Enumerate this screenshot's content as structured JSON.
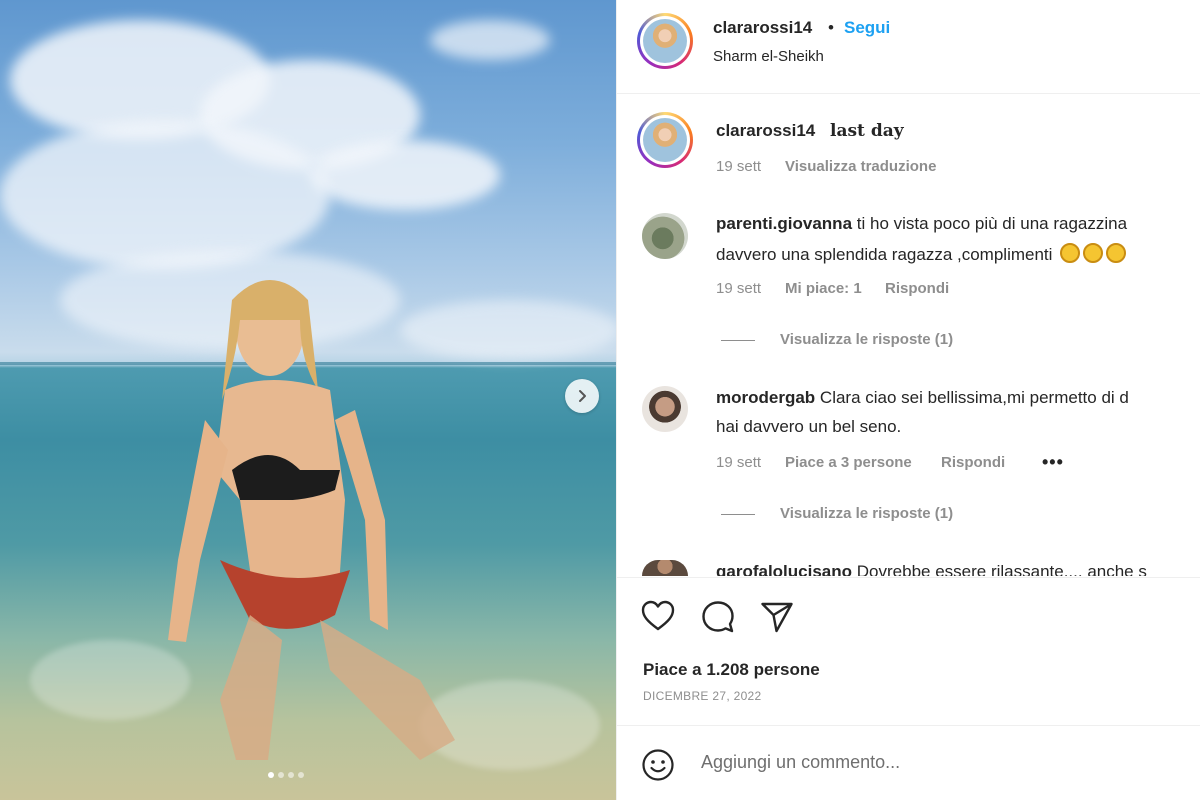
{
  "post": {
    "image": {
      "alt": "",
      "carousel_dots": 4,
      "active_dot": 0,
      "next_icon": "chevron-right-icon"
    },
    "header": {
      "username": "clararossi14",
      "separator": "•",
      "follow_label": "Segui",
      "location": "Sharm el-Sheikh"
    },
    "caption": {
      "username": "clararossi14",
      "text": "last day",
      "time": "19 sett",
      "translate_label": "Visualizza traduzione"
    },
    "comments": [
      {
        "username": "parenti.giovanna",
        "line1": "ti ho vista poco più di una ragazzina",
        "line2": "davvero una splendida ragazza ,complimenti",
        "time": "19 sett",
        "likes": "Mi piace: 1",
        "reply_label": "Rispondi",
        "view_replies": "Visualizza le risposte (1)"
      },
      {
        "username": "morodergab",
        "line1": "Clara ciao sei bellissima,mi permetto di d",
        "line2": "hai davvero un bel seno.",
        "time": "19 sett",
        "likes": "Piace a 3 persone",
        "reply_label": "Rispondi",
        "more": "•••",
        "view_replies": "Visualizza le risposte (1)"
      },
      {
        "username": "garofalolucisano",
        "line1": "Dovrebbe essere rilassante.... anche s"
      }
    ],
    "actions": {
      "like_icon": "heart-icon",
      "comment_icon": "comment-icon",
      "share_icon": "send-icon"
    },
    "likes_text": "Piace a 1.208 persone",
    "date": "DICEMBRE 27, 2022",
    "comment_box": {
      "emoji_icon": "smiley-icon",
      "placeholder": "Aggiungi un commento..."
    }
  },
  "colors": {
    "link_blue": "#1da1f2",
    "muted": "#8e8e8e",
    "text": "#262626"
  }
}
